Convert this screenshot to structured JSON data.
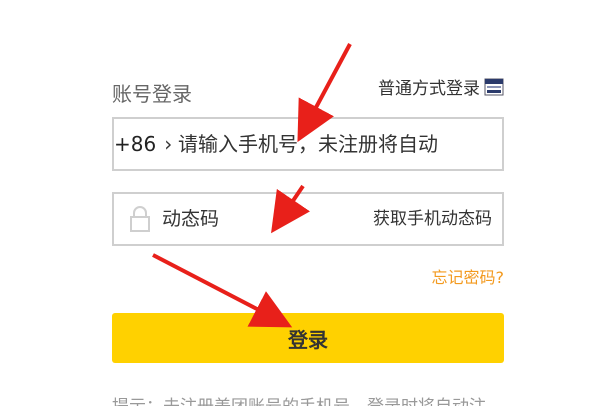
{
  "login": {
    "title": "账号登录",
    "switch_mode_label": "普通方式登录",
    "phone": {
      "prefix": "+86",
      "placeholder": "请输入手机号，未注册将自动"
    },
    "code": {
      "placeholder": "动态码",
      "get_code_label": "获取手机动态码"
    },
    "forgot_password": "忘记密码?",
    "submit_label": "登录",
    "tip": "提示：未注册美团账号的手机号，登录时将自动注"
  },
  "colors": {
    "accent": "#ffd100",
    "link_orange": "#f39a1f",
    "annotation_arrow": "#e8201a"
  },
  "icons": {
    "qr": "qr-code-icon",
    "chevron": "chevron-right-icon",
    "lock": "lock-icon"
  }
}
